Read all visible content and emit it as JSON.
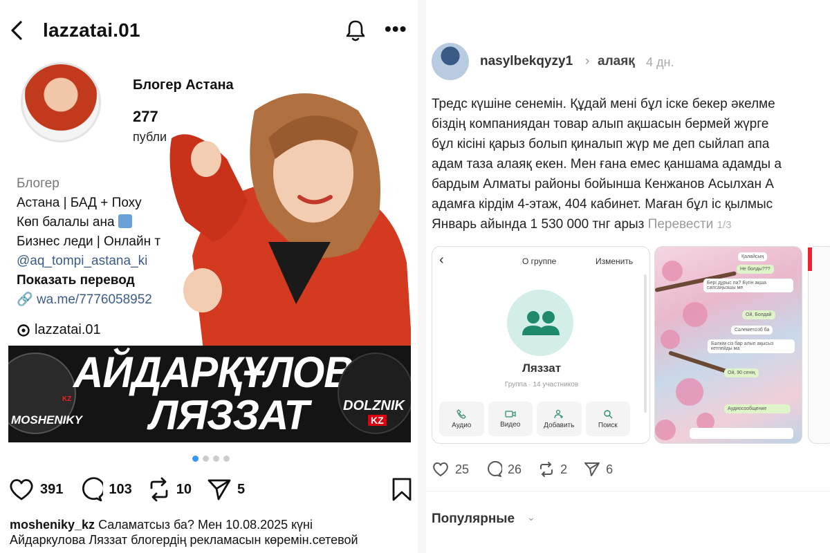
{
  "instagram": {
    "username": "lazzatai.01",
    "profile": {
      "name": "Блогер Астана",
      "posts_count": "277",
      "posts_label": "публи"
    },
    "bio": {
      "category": "Блогер",
      "line1": "Астана | БАД + Поху",
      "line2": "Көп балалы ана",
      "line3": "Бизнес леди | Онлайн т",
      "mention": "@aq_tompi_astana_ki",
      "translate": "Показать перевод",
      "link": "wa.me/7776058952",
      "threads": "lazzatai.01"
    },
    "banner": {
      "line1": "АЙДАРҚҰЛОВА",
      "line2": "ЛЯЗЗАТ",
      "logo_left": "MOSHENIKY",
      "logo_left_kz": "KZ",
      "logo_right": "DOLZNIK",
      "logo_right_kz": "KZ"
    },
    "actions": {
      "likes": "391",
      "comments": "103",
      "reposts": "10",
      "shares": "5"
    },
    "caption": {
      "user": "mosheniky_kz",
      "line1": "Саламатсыз ба? Мен 10.08.2025 күні",
      "line2": "Айдаркулова Ляззат блогердің рекламасын көремін.сетевой"
    },
    "carousel": {
      "total": 4,
      "active": 1
    }
  },
  "threads": {
    "username": "nasylbekqyzy1",
    "topic": "алаяқ",
    "time": "4 дн.",
    "text_lines": [
      "Тредс күшіне сенемін. Құдай мені бұл іске бекер әкелме",
      "біздің компаниядан товар алып ақшасын бермей жүрге",
      "бұл кісіні қарыз болып қиналып жүр ме деп сыйлап апа",
      "адам таза алаяқ екен. Мен ғана емес қаншама адамды а",
      "бардым Алматы районы бойынша Кенжанов Асылхан А",
      "адамға кірдім 4-этаж, 404 кабинет. Маған бұл іс қылмыс",
      "Январь айында 1 530 000 тнг арыз"
    ],
    "translate": "Перевести",
    "page_indicator": "1/3",
    "group_screenshot": {
      "header_title": "О группе",
      "header_edit": "Изменить",
      "group_name": "Ляззат",
      "group_sub": "Группа · 14 участников",
      "buttons": [
        "Аудио",
        "Видео",
        "Добавить",
        "Поиск"
      ]
    },
    "chat_screenshot": {
      "bubbles": [
        "Қалайсың",
        "Не болды???",
        "Бері дұрыс па? Бүгін ақша салсаңызшы ме",
        "Ой, Болдай",
        "Сәлеметсізб ба",
        "Бәлкім сіз бар алып ақысыз кетпейды ма",
        "Ой, 90 сенің",
        "Аудиосообщение"
      ]
    },
    "actions": {
      "likes": "25",
      "comments": "26",
      "reposts": "2",
      "shares": "6"
    },
    "popular": "Популярные"
  }
}
